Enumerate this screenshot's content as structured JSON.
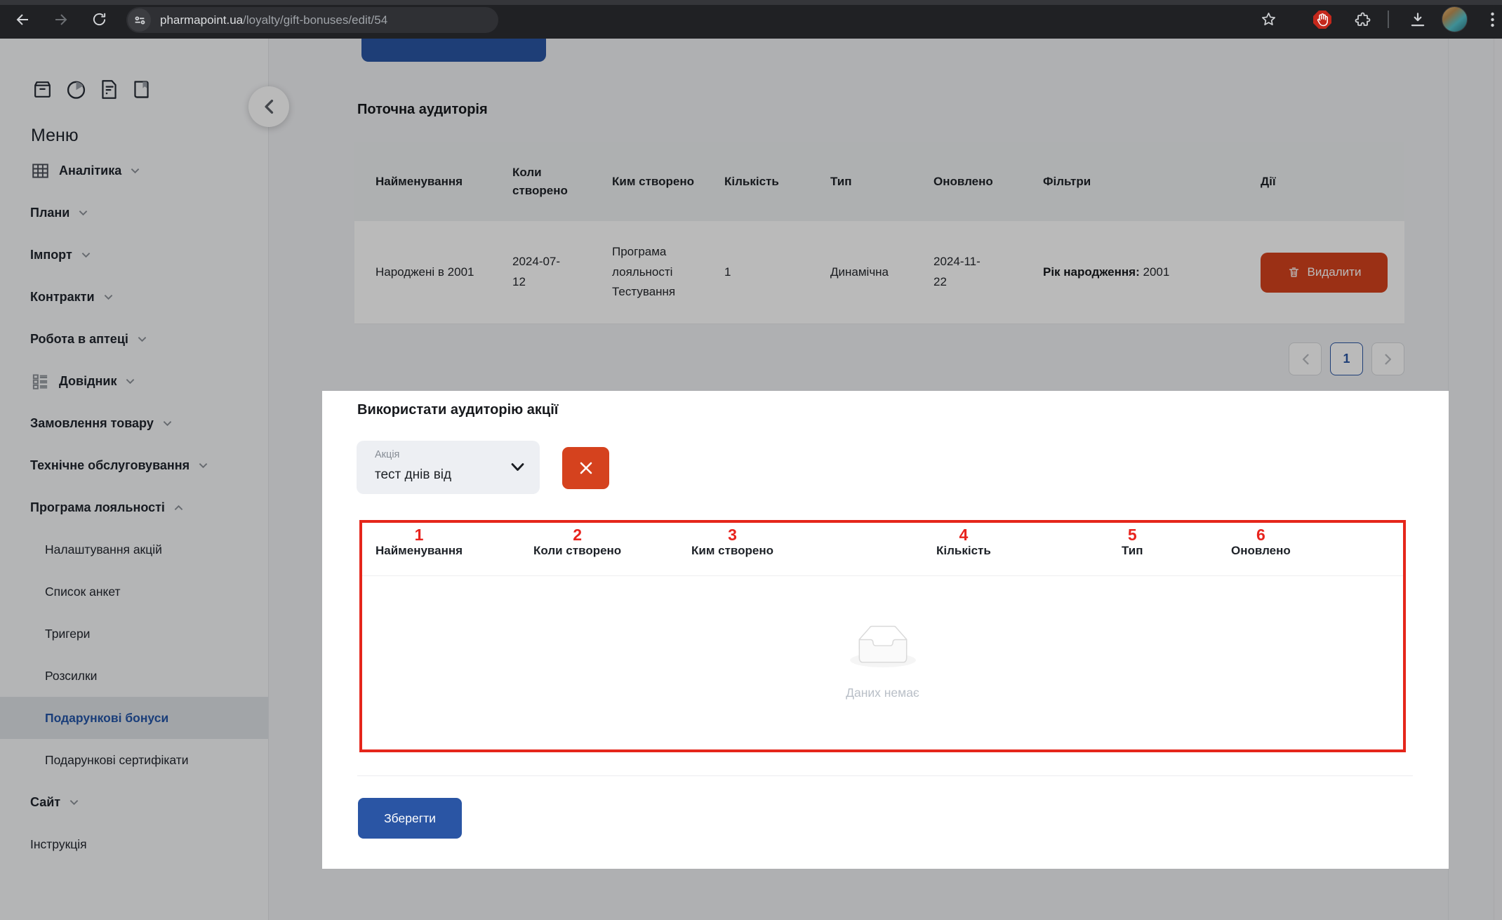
{
  "colors": {
    "primary_blue": "#2a55a4",
    "danger_red": "#d5421e",
    "annotation_red": "#e8231d",
    "active_menu_blue": "#2456a8"
  },
  "browser": {
    "url_domain": "pharmapoint.ua",
    "url_path": "/loyalty/gift-bonuses/edit/54"
  },
  "sidebar": {
    "menu_title": "Меню",
    "items": [
      {
        "label": "Аналітика"
      },
      {
        "label": "Плани"
      },
      {
        "label": "Імпорт"
      },
      {
        "label": "Контракти"
      },
      {
        "label": "Робота в аптеці"
      },
      {
        "label": "Довідник"
      },
      {
        "label": "Замовлення товару"
      },
      {
        "label": "Технічне обслуговування"
      },
      {
        "label": "Програма лояльності"
      }
    ],
    "loyalty_subitems": [
      "Налаштування акцій",
      "Список анкет",
      "Тригери",
      "Розсилки",
      "Подарункові бонуси",
      "Подарункові сертифікати"
    ],
    "site_item": "Сайт",
    "instruction_item": "Інструкція"
  },
  "main": {
    "section_title": "Поточна аудиторія",
    "table": {
      "columns": [
        "Найменування",
        "Коли створено",
        "Ким створено",
        "Кількість",
        "Тип",
        "Оновлено",
        "Фільтри",
        "Дії"
      ],
      "row": {
        "name": "Народжені в 2001",
        "created_when": "2024-07-12",
        "created_by": "Програма лояльності Тестування",
        "count": "1",
        "type": "Динамічна",
        "updated": "2024-11-22",
        "filter_label": "Рік народження:",
        "filter_value": "2001",
        "delete_button": "Видалити"
      }
    },
    "pagination": {
      "current_page": "1"
    }
  },
  "panel": {
    "title": "Використати аудиторію акції",
    "select": {
      "label": "Акція",
      "value": "тест днів від"
    },
    "table": {
      "columns": [
        {
          "num": "1",
          "label": "Найменування"
        },
        {
          "num": "2",
          "label": "Коли створено"
        },
        {
          "num": "3",
          "label": "Ким створено"
        },
        {
          "num": "4",
          "label": "Кількість"
        },
        {
          "num": "5",
          "label": "Тип"
        },
        {
          "num": "6",
          "label": "Оновлено"
        }
      ],
      "empty_text": "Даних немає"
    },
    "save_button": "Зберегти"
  }
}
